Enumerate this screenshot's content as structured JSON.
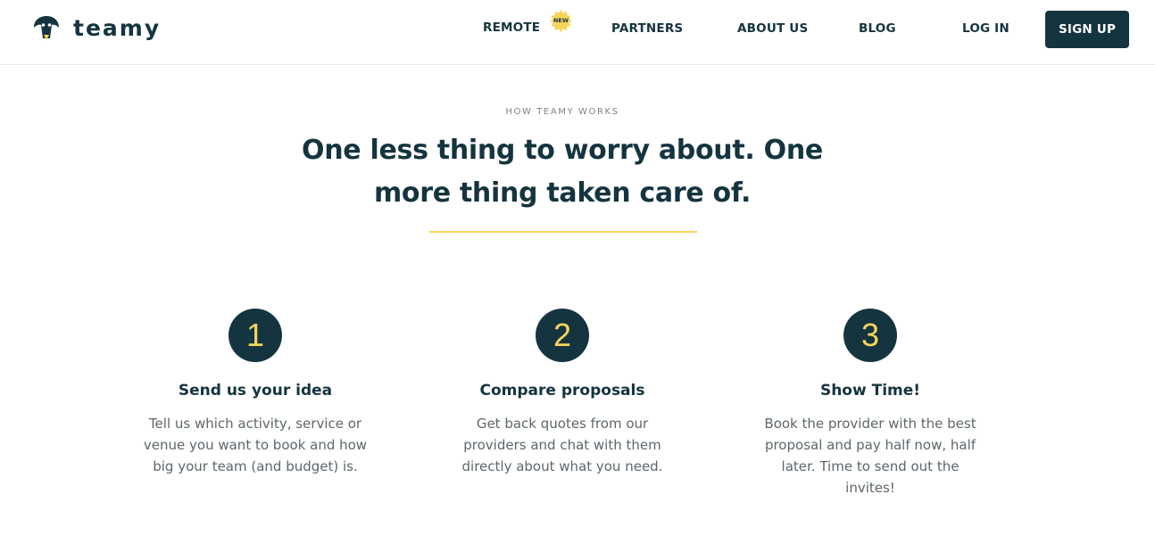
{
  "header": {
    "brand": "teamy",
    "nav": {
      "remote": "REMOTE",
      "remote_badge": "NEW",
      "partners": "PARTNERS",
      "about": "ABOUT US",
      "blog": "BLOG",
      "login": "LOG IN",
      "signup": "SIGN UP"
    },
    "logo_icon": "penguin-icon",
    "badge_icon": "starburst-badge-icon",
    "colors": {
      "brand_dark": "#14343f",
      "accent_yellow": "#f6d55c"
    }
  },
  "hero": {
    "eyebrow": "HOW TEAMY WORKS",
    "headline": "One less thing to worry about. One more thing taken care of."
  },
  "steps": [
    {
      "number": "1",
      "title": "Send us your idea",
      "text": "Tell us which activity, service or venue you want to book and how big your team (and budget) is."
    },
    {
      "number": "2",
      "title": "Compare proposals",
      "text": "Get back quotes from our providers and chat with them directly about what you need."
    },
    {
      "number": "3",
      "title": "Show Time!",
      "text": "Book the provider with the best proposal and pay half now, half later. Time to send out the invites!"
    }
  ]
}
